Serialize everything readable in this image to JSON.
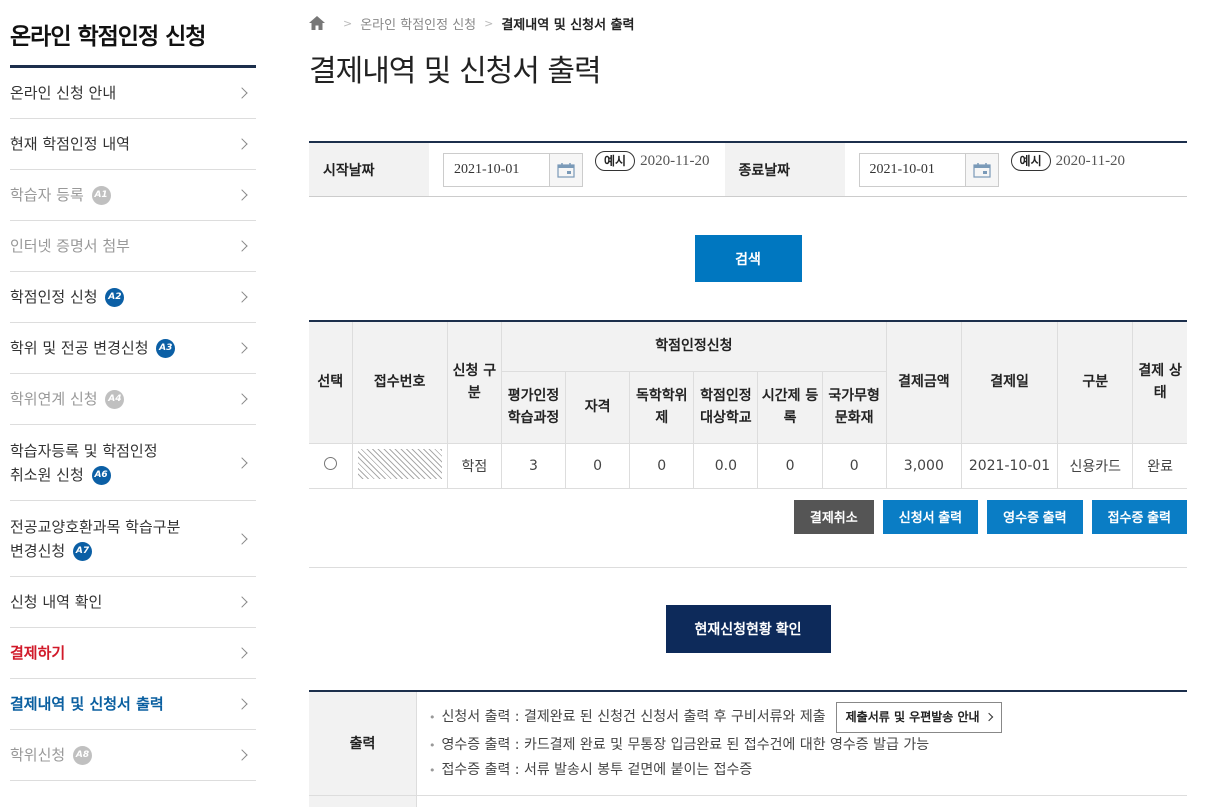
{
  "sidebar": {
    "title": "온라인 학점인정 신청",
    "items": [
      {
        "label": "온라인 신청 안내",
        "badge": ""
      },
      {
        "label": "현재 학점인정 내역",
        "badge": ""
      },
      {
        "label": "학습자 등록",
        "badge": "A1"
      },
      {
        "label": "인터넷 증명서 첨부",
        "badge": ""
      },
      {
        "label": "학점인정 신청",
        "badge": "A2"
      },
      {
        "label": "학위 및 전공 변경신청",
        "badge": "A3"
      },
      {
        "label": "학위연계 신청",
        "badge": "A4"
      },
      {
        "label": "학습자등록 및 학점인정",
        "label2": "취소원 신청",
        "badge": "A6"
      },
      {
        "label": "전공교양호환과목 학습구분",
        "label2": "변경신청",
        "badge": "A7"
      },
      {
        "label": "신청 내역 확인",
        "badge": ""
      },
      {
        "label": "결제하기",
        "badge": ""
      },
      {
        "label": "결제내역 및 신청서 출력",
        "badge": ""
      },
      {
        "label": "학위신청",
        "badge": "A8"
      }
    ]
  },
  "breadcrumb": {
    "items": [
      "온라인 학점인정 신청",
      "결제내역 및 신청서 출력"
    ]
  },
  "page": {
    "title": "결제내역 및 신청서 출력"
  },
  "search": {
    "start_label": "시작날짜",
    "start_value": "2021-10-01",
    "end_label": "종료날짜",
    "end_value": "2021-10-01",
    "example_pill": "예시",
    "example_value": "2020-11-20",
    "search_button": "검색"
  },
  "table": {
    "headers": {
      "select": "선택",
      "receipt_no": "접수번호",
      "apply_type": "신청 구분",
      "group": "학점인정신청",
      "sub": [
        "평가인정 학습과정",
        "자격",
        "독학학위 제",
        "학점인정 대상학교",
        "시간제 등록",
        "국가무형 문화재"
      ],
      "amount": "결제금액",
      "pay_date": "결제일",
      "kind": "구분",
      "pay_status": "결제 상태"
    },
    "rows": [
      {
        "apply_type": "학점",
        "sub": [
          "3",
          "0",
          "0",
          "0.0",
          "0",
          "0"
        ],
        "amount": "3,000",
        "pay_date": "2021-10-01",
        "kind": "신용카드",
        "pay_status": "완료"
      }
    ]
  },
  "actions": {
    "cancel": "결제취소",
    "print_application": "신청서 출력",
    "print_receipt": "영수증 출력",
    "print_acceptance": "접수증 출력"
  },
  "status_button": "현재신청현황 확인",
  "info": {
    "label": "출력",
    "lines": [
      "신청서 출력 : 결제완료 된 신청건 신청서 출력 후 구비서류와 제출",
      "영수증 출력 : 카드결제 완료 및 무통장 입금완료 된 접수건에 대한 영수증 발급 가능",
      "접수증 출력 : 서류 발송시 봉투 겉면에 붙이는 접수증"
    ],
    "link_button": "제출서류 및 우편발송 안내"
  },
  "colors": {
    "navy": "#1c2f4c",
    "blue": "#0077c0",
    "red": "#d11a2a"
  }
}
